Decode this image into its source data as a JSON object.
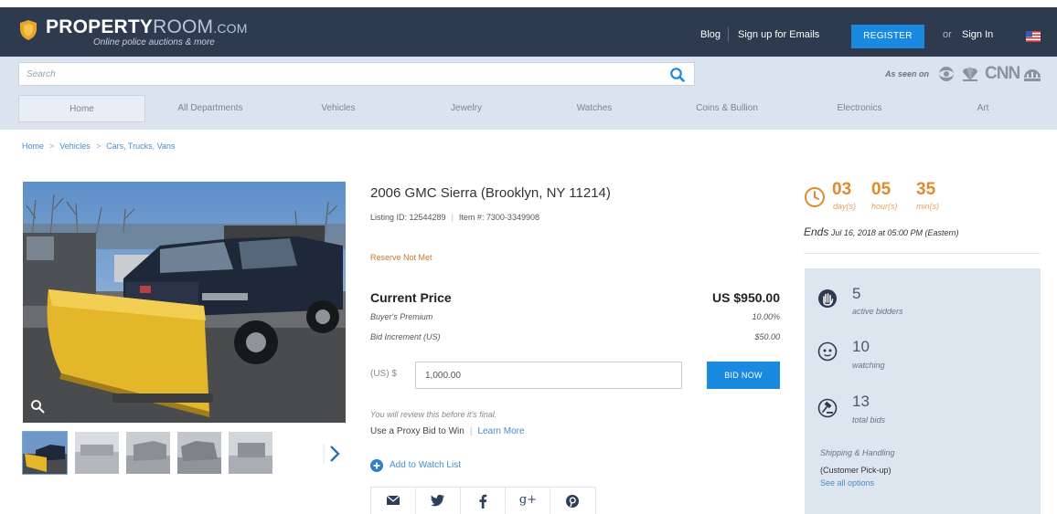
{
  "colors": {
    "header_bg": "#2e3a4e",
    "accent_blue": "#1a8ae0",
    "countdown_orange": "#e08a2c",
    "link_blue": "#4a8cc9",
    "panel_bg": "#dde5ee"
  },
  "header": {
    "logo_bold": "PROPERTY",
    "logo_light": "ROOM",
    "logo_suffix": ".COM",
    "tagline": "Online police auctions & more",
    "blog_label": "Blog",
    "emails_label": "Sign up for Emails",
    "register_label": "REGISTER",
    "or_label": "or",
    "signin_label": "Sign In",
    "flag_icon": "us-flag-icon"
  },
  "search": {
    "placeholder": "Search",
    "icon": "search-icon",
    "as_seen_on": "As seen on",
    "cnn_label": "CNN"
  },
  "nav": {
    "items": [
      {
        "label": "Home"
      },
      {
        "label": "All Departments"
      },
      {
        "label": "Vehicles"
      },
      {
        "label": "Jewelry"
      },
      {
        "label": "Watches"
      },
      {
        "label": "Coins & Bullion"
      },
      {
        "label": "Electronics"
      },
      {
        "label": "Art"
      }
    ]
  },
  "breadcrumb": {
    "items": [
      "Home",
      "Vehicles",
      "Cars, Trucks, Vans"
    ],
    "separator": ">"
  },
  "listing": {
    "title": "2006 GMC Sierra (Brooklyn, NY 11214)",
    "listing_id": "Listing ID: 12544289",
    "item_number": "Item #: 7300-3349908",
    "reserve_status": "Reserve Not Met",
    "current_price_label": "Current Price",
    "current_price": "US $950.00",
    "buyers_premium_label": "Buyer's Premium",
    "buyers_premium": "10.00%",
    "bid_increment_label": "Bid Increment (US)",
    "bid_increment": "$50.00",
    "currency_prefix": "(US) $",
    "bid_value": "1,000.00",
    "bid_button": "BID NOW",
    "review_note": "You will review this before it's final.",
    "proxy_label": "Use a Proxy Bid to Win",
    "learn_more": "Learn More",
    "watch_label": "Add to Watch List",
    "share_icons": [
      "email-icon",
      "twitter-icon",
      "facebook-icon",
      "google-plus-icon",
      "pinterest-icon"
    ],
    "google_plus_text": "g+"
  },
  "countdown": {
    "days": "03",
    "hours": "05",
    "mins": "35",
    "days_label": "day(s)",
    "hours_label": "hour(s)",
    "mins_label": "min(s)",
    "ends_word": "Ends",
    "ends_text": "Jul 16, 2018 at 05:00 PM (Eastern)"
  },
  "stats": {
    "bidders": "5",
    "bidders_label": "active bidders",
    "watching": "10",
    "watching_label": "watching",
    "bids": "13",
    "bids_label": "total bids",
    "shipping_title": "Shipping & Handling",
    "shipping_value": "(Customer Pick-up)",
    "shipping_link": "See all options"
  }
}
